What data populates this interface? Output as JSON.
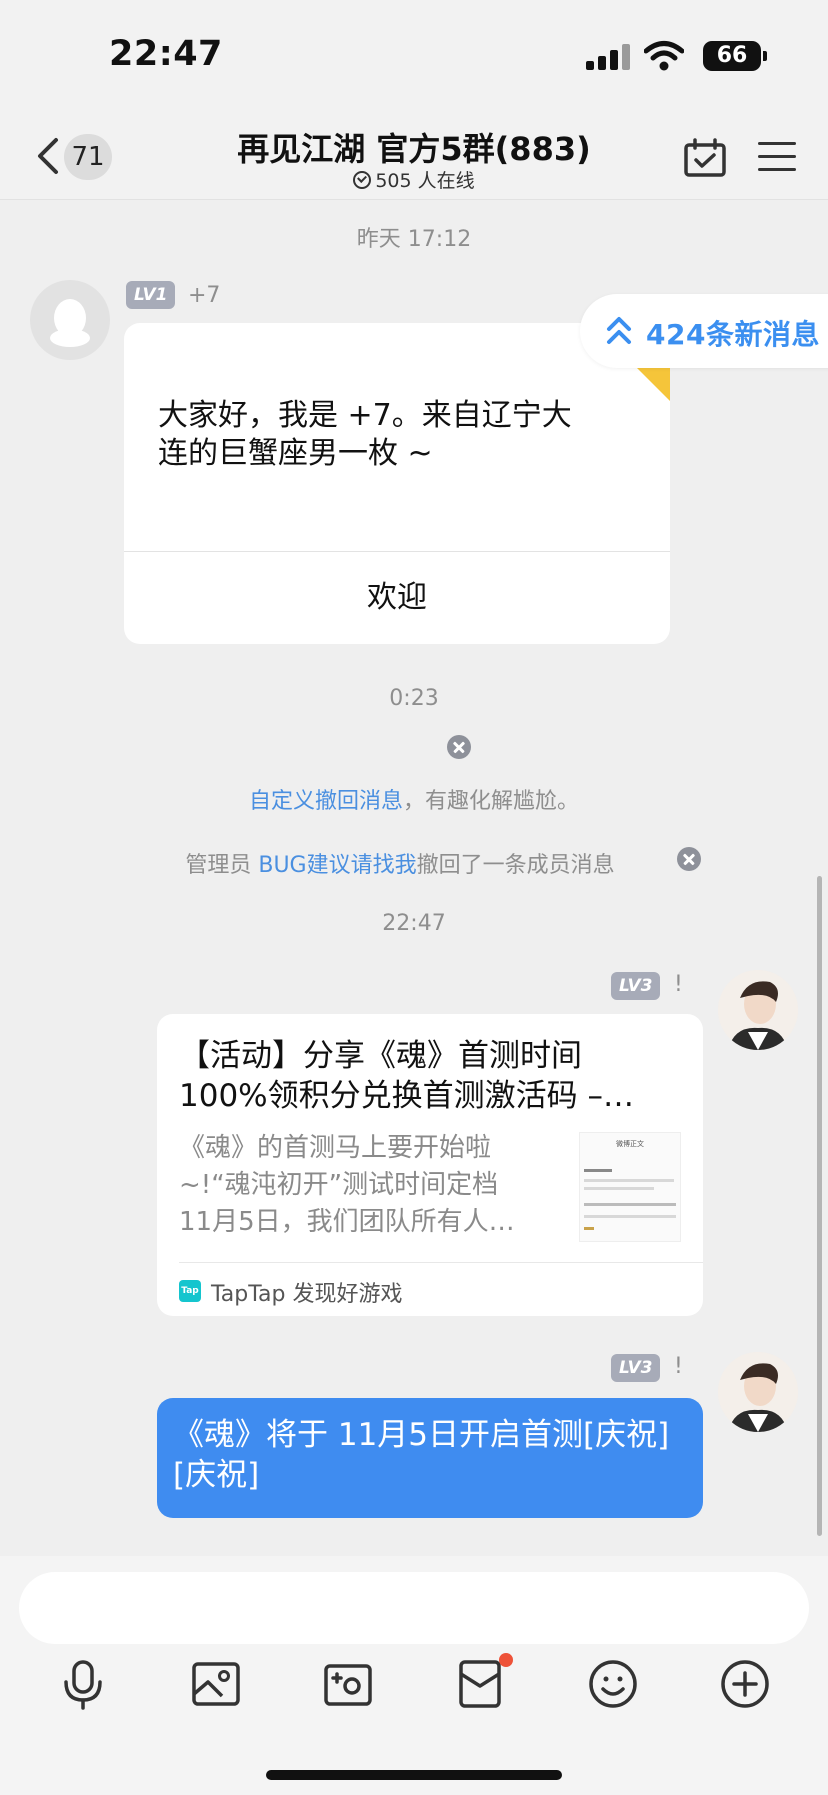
{
  "status_bar": {
    "time": "22:47",
    "battery": "66"
  },
  "header": {
    "back_count": "71",
    "title": "再见江湖 官方5群(883)",
    "online": "505 人在线"
  },
  "new_messages": {
    "label": "424条新消息"
  },
  "messages": {
    "ts1": "昨天 17:12",
    "intro": {
      "level": "LV1",
      "nick": "+7",
      "text": "大家好，我是 +7。来自辽宁大连的巨蟹座男一枚 ~",
      "button": "欢迎"
    },
    "ts2": "0:23",
    "recall_tip": {
      "link": "自定义撤回消息",
      "rest": "，有趣化解尴尬。"
    },
    "admin_recall": {
      "prefix": "管理员 ",
      "admin_name": "BUG建议请找我",
      "suffix": "撤回了一条成员消息"
    },
    "ts3": "22:47",
    "share": {
      "level": "LV3",
      "nick": "!",
      "title_line1": "【活动】分享《魂》首测时间",
      "title_line2": "100%领积分兑换首测激活码 –…",
      "desc": "《魂》的首测马上要开始啦~!“魂沌初开”测试时间定档11月5日，我们团队所有人…",
      "thumb_title": "微博正文",
      "source_icon": "Tap",
      "source": "TapTap 发现好游戏"
    },
    "blue": {
      "level": "LV3",
      "nick": "!",
      "text": "《魂》将于 11月5日开启首测[庆祝][庆祝]"
    }
  },
  "input": {
    "placeholder": ""
  },
  "toolbar": [
    "microphone-icon",
    "image-icon",
    "camera-icon",
    "red-envelope-icon",
    "emoji-icon",
    "plus-icon"
  ],
  "colors": {
    "accent": "#3f8cf0",
    "link": "#4a8fe0",
    "ribbon": "#f5c53a",
    "badge": "#a7abb8"
  }
}
